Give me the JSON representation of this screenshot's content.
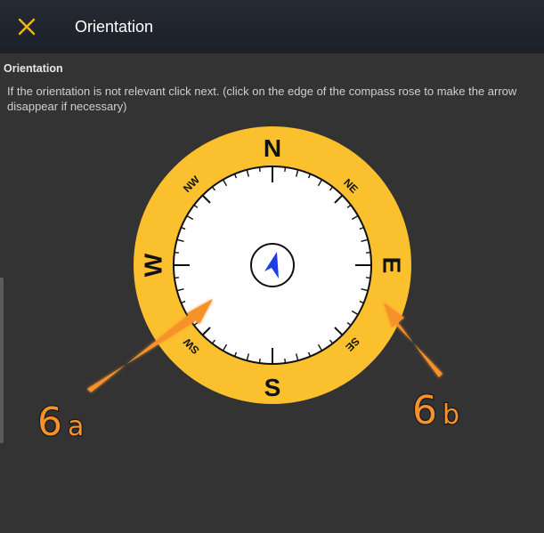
{
  "header": {
    "title": "Orientation",
    "close_icon": "close-x-icon",
    "accent_color": "#f5b800"
  },
  "content": {
    "section_title": "Orientation",
    "instructions": "If the orientation is not relevant click next. (click on the edge of the compass rose to make the arrow disappear if necessary)"
  },
  "compass": {
    "ring_color": "#fbc02d",
    "face_color": "#ffffff",
    "arrow_color": "#1a3ee8",
    "cardinals": {
      "n": "N",
      "e": "E",
      "s": "S",
      "w": "W"
    },
    "intercardinals": {
      "nw": "NW",
      "ne": "NE",
      "sw": "SW",
      "se": "SE"
    },
    "center_icon": "navigation-arrow-icon"
  },
  "annotations": {
    "callout_a": {
      "number": "6",
      "letter": "a"
    },
    "callout_b": {
      "number": "6",
      "letter": "b"
    },
    "arrow_color": "#f7912c"
  }
}
